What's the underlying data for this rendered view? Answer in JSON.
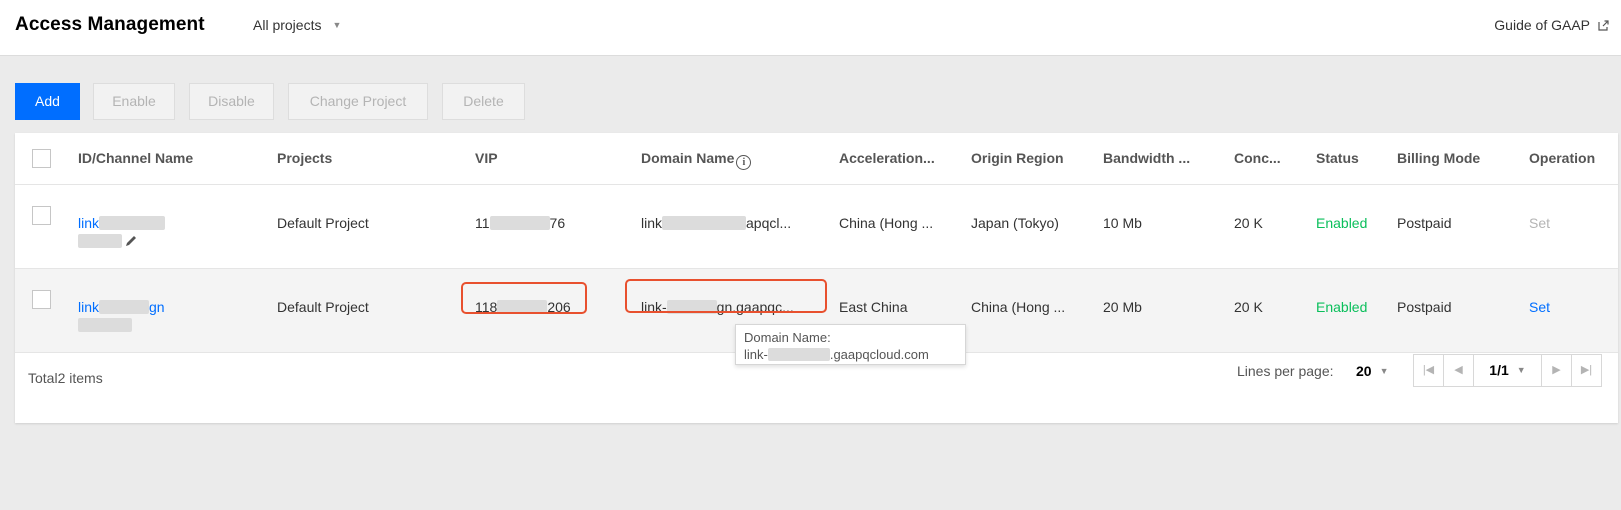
{
  "header": {
    "title": "Access Management",
    "project_filter": "All projects",
    "guide_link": "Guide of GAAP",
    "guide_icon": "external-link-icon"
  },
  "toolbar": {
    "add": "Add",
    "enable": "Enable",
    "disable": "Disable",
    "change_project": "Change Project",
    "delete": "Delete"
  },
  "table": {
    "columns": [
      "ID/Channel Name",
      "Projects",
      "VIP",
      "Domain Name",
      "Acceleration...",
      "Origin Region",
      "Bandwidth ...",
      "Conc...",
      "Status",
      "Billing Mode",
      "Operation"
    ],
    "rows": [
      {
        "id_prefix": "link",
        "id_suffix": "",
        "project": "Default Project",
        "vip_prefix": "11",
        "vip_suffix": "76",
        "domain_prefix": "link",
        "domain_suffix": "apqcl...",
        "acceleration": "China (Hong ...",
        "origin": "Japan (Tokyo)",
        "bandwidth": "10 Mb",
        "concurrency": "20 K",
        "status": "Enabled",
        "billing": "Postpaid",
        "operation": "Set",
        "operation_enabled": false
      },
      {
        "id_prefix": "link",
        "id_suffix": "gn",
        "project": "Default Project",
        "vip_prefix": "118",
        "vip_suffix": "206",
        "domain_prefix": "link-",
        "domain_suffix": "gn.gaapqc...",
        "acceleration": "East China",
        "origin": "China (Hong ...",
        "bandwidth": "20 Mb",
        "concurrency": "20 K",
        "status": "Enabled",
        "billing": "Postpaid",
        "operation": "Set",
        "operation_enabled": true
      }
    ]
  },
  "tooltip": {
    "label": "Domain Name:",
    "value_prefix": "link-",
    "value_suffix": ".gaapqcloud.com"
  },
  "footer": {
    "total": "Total2 items",
    "lines_label": "Lines per page:",
    "lines_value": "20",
    "page": "1/1"
  },
  "colors": {
    "primary": "#006eff",
    "enabled": "#0abf5b",
    "highlight": "#e8502e"
  }
}
